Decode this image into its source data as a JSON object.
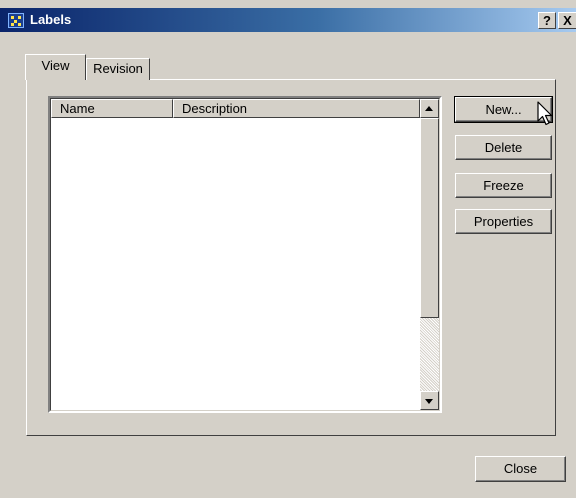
{
  "window": {
    "title": "Labels",
    "help_label": "?",
    "close_label": "X"
  },
  "tabs": [
    {
      "label": "View",
      "active": true
    },
    {
      "label": "Revision",
      "active": false
    }
  ],
  "list": {
    "columns": [
      "Name",
      "Description"
    ],
    "rows": []
  },
  "buttons": {
    "new": "New...",
    "delete": "Delete",
    "freeze": "Freeze",
    "properties": "Properties",
    "close": "Close"
  },
  "icons": {
    "title_icon": "labels-app-icon",
    "cursor": "mouse-pointer-icon"
  }
}
